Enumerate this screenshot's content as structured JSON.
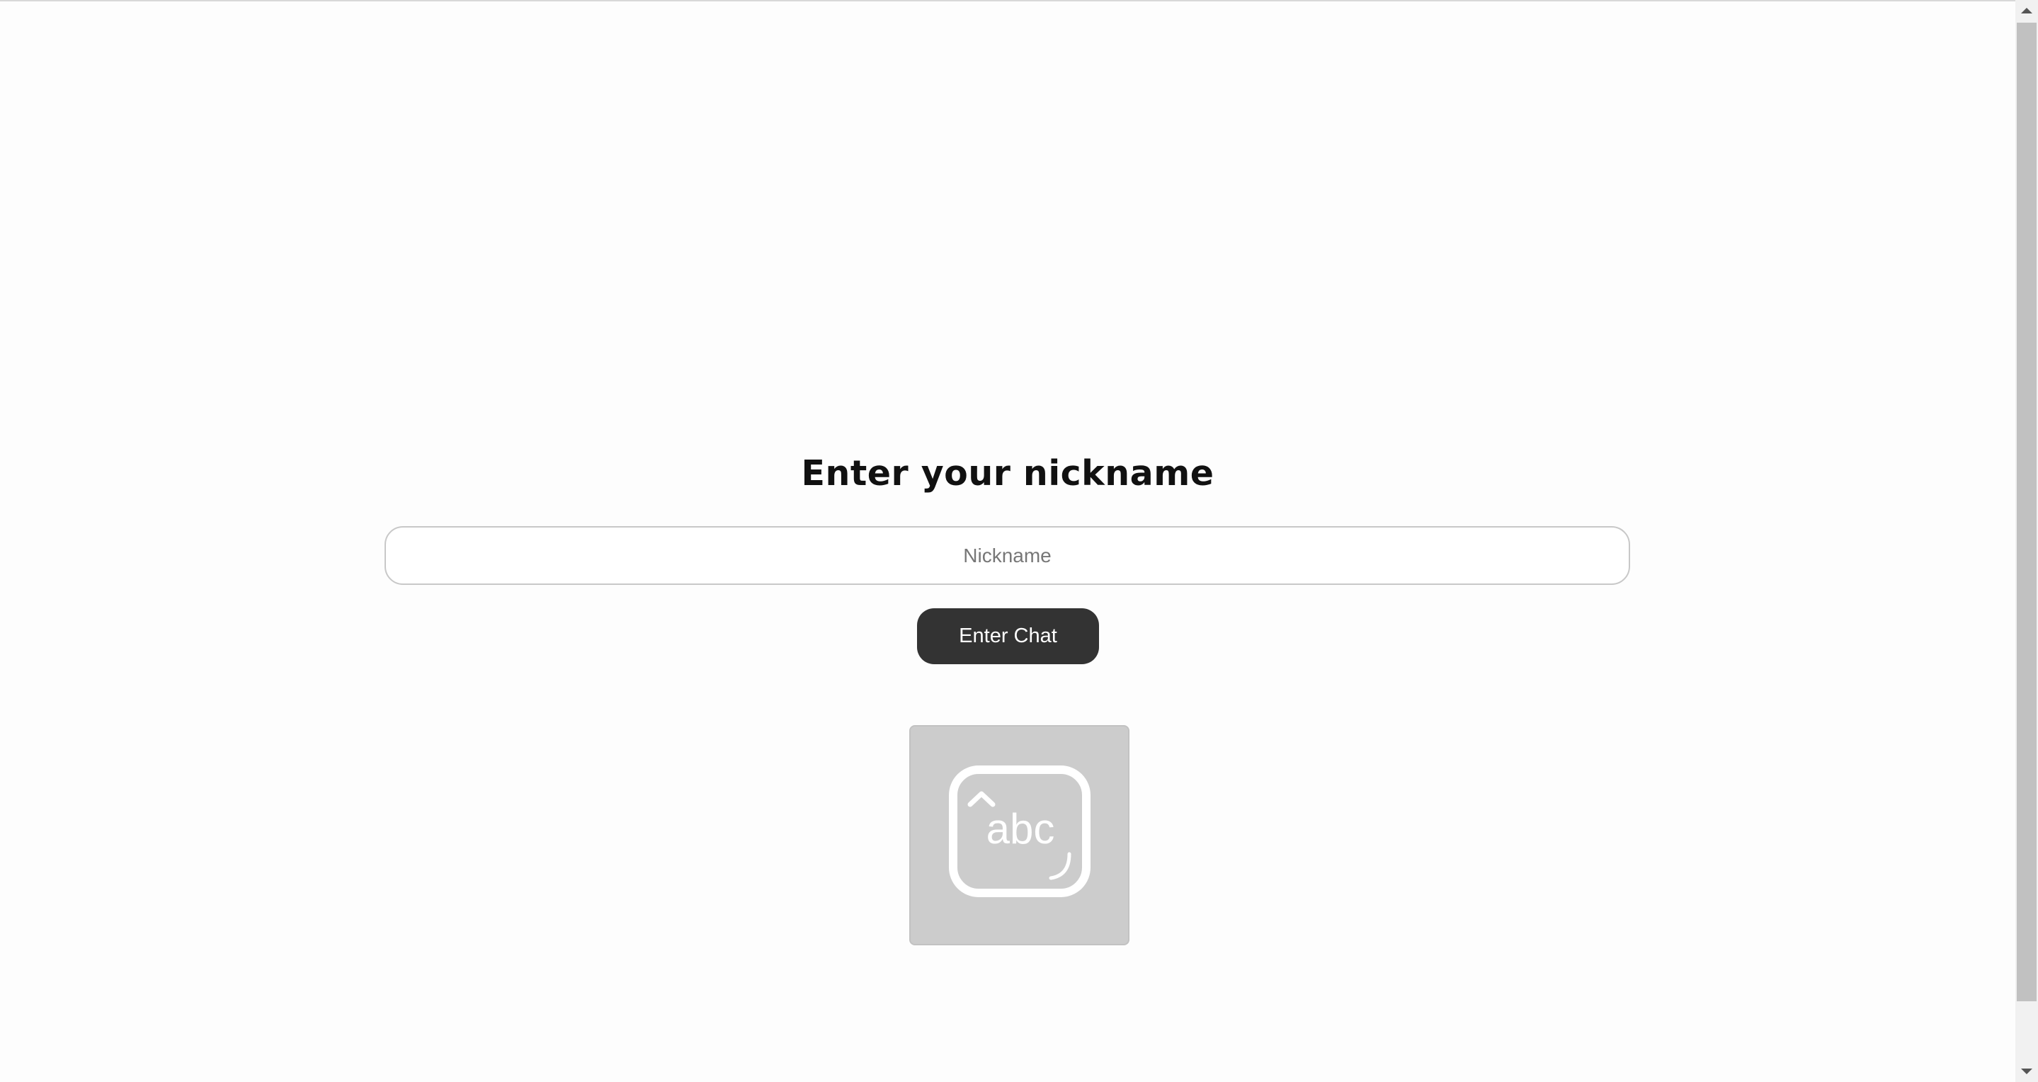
{
  "login": {
    "title": "Enter your nickname",
    "nickname_placeholder": "Nickname",
    "nickname_value": "",
    "submit_label": "Enter Chat"
  },
  "keyboard_icon": {
    "name": "keyboard-icon",
    "label": "abc",
    "tile_color": "#cccccc",
    "glyph_color": "#ffffff"
  },
  "colors": {
    "button_bg": "#333333",
    "button_text": "#ffffff",
    "page_bg": "#fdfdfd"
  }
}
